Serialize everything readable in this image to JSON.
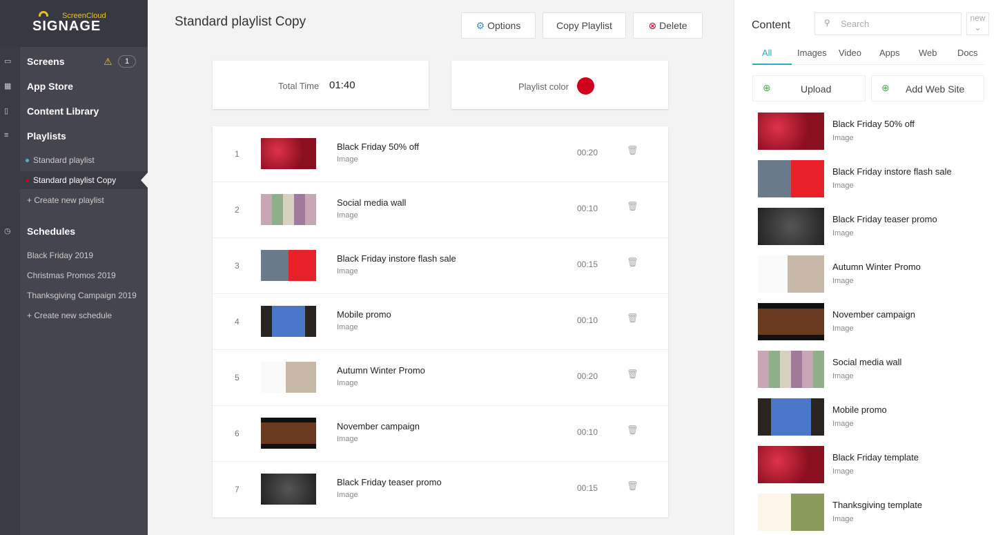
{
  "logo": {
    "brand": "ScreenCloud",
    "product": "SIGNAGE"
  },
  "nav": {
    "screens": "Screens",
    "screens_count": "1",
    "app_store": "App Store",
    "content_library": "Content Library",
    "playlists": "Playlists",
    "playlist_items": [
      {
        "label": "Standard playlist",
        "color": "#4fb3bf"
      },
      {
        "label": "Standard playlist Copy",
        "color": "#d0021b"
      }
    ],
    "create_playlist": "Create new playlist",
    "schedules": "Schedules",
    "schedule_items": [
      "Black Friday 2019",
      "Christmas Promos 2019",
      "Thanksgiving Campaign 2019"
    ],
    "create_schedule": "Create new schedule"
  },
  "header": {
    "title": "Standard playlist Copy",
    "options": "Options",
    "copy": "Copy Playlist",
    "delete": "Delete"
  },
  "summary": {
    "total_time_label": "Total Time",
    "total_time": "01:40",
    "color_label": "Playlist color",
    "color": "#d0021b"
  },
  "playlist": [
    {
      "n": "1",
      "title": "Black Friday 50% off",
      "type": "Image",
      "duration": "00:20",
      "thumb": "red"
    },
    {
      "n": "2",
      "title": "Social media wall",
      "type": "Image",
      "duration": "00:10",
      "thumb": "mosaic"
    },
    {
      "n": "3",
      "title": "Black Friday instore flash sale",
      "type": "Image",
      "duration": "00:15",
      "thumb": "store"
    },
    {
      "n": "4",
      "title": "Mobile promo",
      "type": "Image",
      "duration": "00:10",
      "thumb": "mobile"
    },
    {
      "n": "5",
      "title": "Autumn Winter Promo",
      "type": "Image",
      "duration": "00:20",
      "thumb": "autumn"
    },
    {
      "n": "6",
      "title": "November campaign",
      "type": "Image",
      "duration": "00:10",
      "thumb": "movie"
    },
    {
      "n": "7",
      "title": "Black Friday teaser promo",
      "type": "Image",
      "duration": "00:15",
      "thumb": "teaser"
    }
  ],
  "content": {
    "title": "Content",
    "search_placeholder": "Search",
    "sort": "new",
    "tabs": [
      "All",
      "Images",
      "Video",
      "Apps",
      "Web",
      "Docs"
    ],
    "active_tab": "All",
    "upload": "Upload",
    "add_web": "Add Web Site",
    "items": [
      {
        "title": "Black Friday 50% off",
        "type": "Image",
        "thumb": "red"
      },
      {
        "title": "Black Friday instore flash sale",
        "type": "Image",
        "thumb": "store"
      },
      {
        "title": "Black Friday teaser promo",
        "type": "Image",
        "thumb": "teaser"
      },
      {
        "title": "Autumn Winter Promo",
        "type": "Image",
        "thumb": "autumn"
      },
      {
        "title": "November campaign",
        "type": "Image",
        "thumb": "movie"
      },
      {
        "title": "Social media wall",
        "type": "Image",
        "thumb": "mosaic"
      },
      {
        "title": "Mobile promo",
        "type": "Image",
        "thumb": "mobile"
      },
      {
        "title": "Black Friday template",
        "type": "Image",
        "thumb": "red"
      },
      {
        "title": "Thanksgiving template",
        "type": "Image",
        "thumb": "thanks"
      }
    ]
  }
}
